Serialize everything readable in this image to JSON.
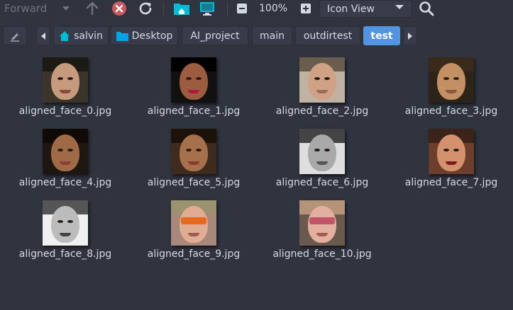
{
  "toolbar": {
    "forward_label": "Forward",
    "zoom_level": "100%",
    "view_mode": "Icon View",
    "icons": [
      "chevron-down-icon",
      "up-arrow-icon",
      "stop-icon",
      "reload-icon",
      "home-folder-icon",
      "computer-icon",
      "zoom-out-icon",
      "zoom-in-icon",
      "search-icon"
    ]
  },
  "pathbar": {
    "crumbs": [
      "salvin",
      "Desktop",
      "AI_project",
      "main",
      "outdirtest",
      "test"
    ],
    "active_crumb": "test"
  },
  "files": [
    {
      "name": "aligned_face_0.jpg"
    },
    {
      "name": "aligned_face_1.jpg"
    },
    {
      "name": "aligned_face_2.jpg"
    },
    {
      "name": "aligned_face_3.jpg"
    },
    {
      "name": "aligned_face_4.jpg"
    },
    {
      "name": "aligned_face_5.jpg"
    },
    {
      "name": "aligned_face_6.jpg"
    },
    {
      "name": "aligned_face_7.jpg"
    },
    {
      "name": "aligned_face_8.jpg"
    },
    {
      "name": "aligned_face_9.jpg"
    },
    {
      "name": "aligned_face_10.jpg"
    }
  ],
  "colors": {
    "accent": "#5294e2",
    "stop_red": "#cc575d",
    "folder_teal": "#00bcd4"
  }
}
